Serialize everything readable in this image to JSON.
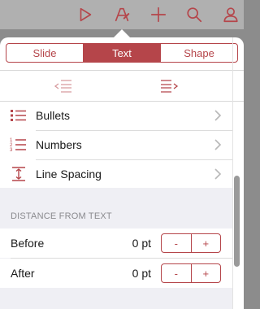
{
  "toolbar": {
    "icons": [
      "play-icon",
      "format-brush-icon",
      "plus-icon",
      "search-icon",
      "person-icon"
    ],
    "accent": "#b5454a"
  },
  "segments": {
    "items": [
      {
        "label": "Slide",
        "active": false
      },
      {
        "label": "Text",
        "active": true
      },
      {
        "label": "Shape",
        "active": false
      }
    ]
  },
  "list": {
    "items": [
      {
        "label": "Bullets",
        "icon": "bullets-icon"
      },
      {
        "label": "Numbers",
        "icon": "numbers-icon"
      },
      {
        "label": "Line Spacing",
        "icon": "line-spacing-icon"
      }
    ]
  },
  "distance": {
    "header": "DISTANCE FROM TEXT",
    "before": {
      "label": "Before",
      "value": "0 pt"
    },
    "after": {
      "label": "After",
      "value": "0 pt"
    },
    "minus": "-",
    "plus": "+"
  }
}
